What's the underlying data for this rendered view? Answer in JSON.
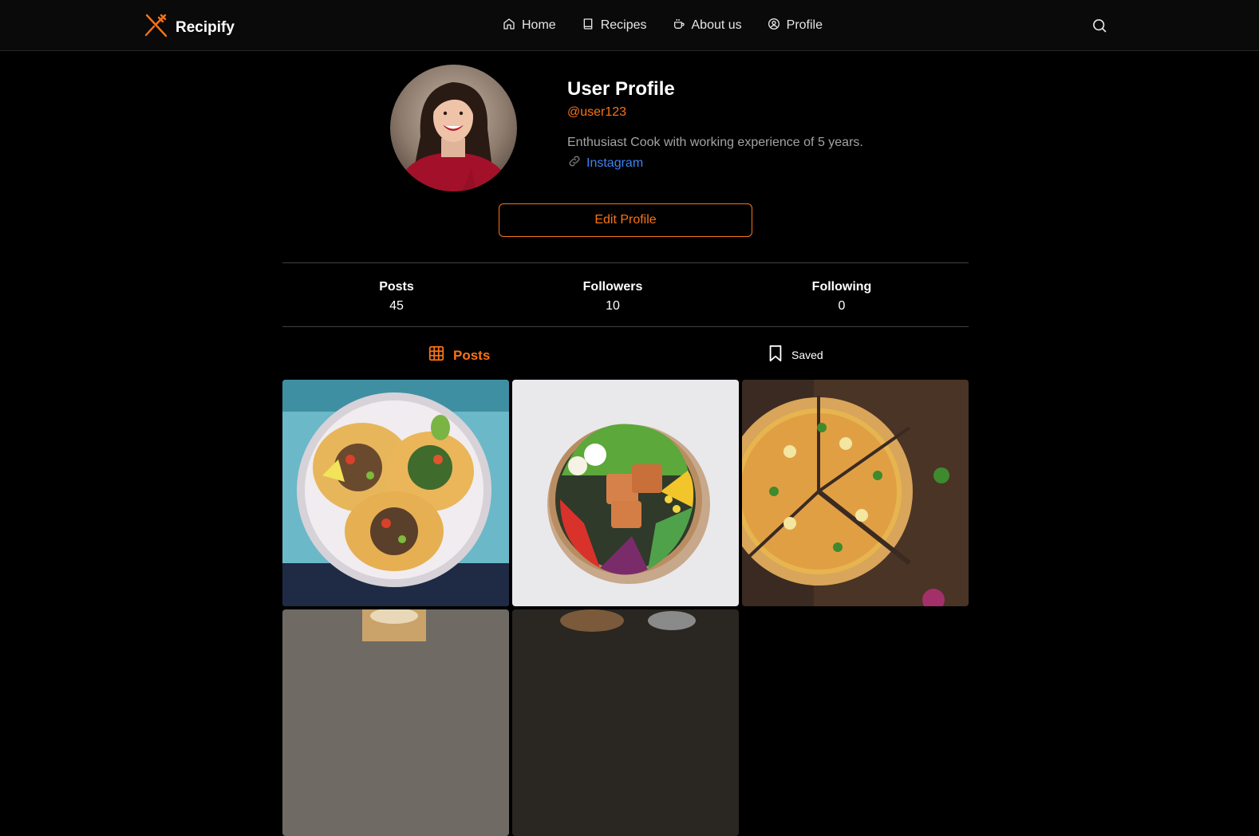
{
  "app": {
    "name": "Recipify"
  },
  "nav": {
    "home": "Home",
    "recipes": "Recipes",
    "about": "About us",
    "profile": "Profile"
  },
  "profile": {
    "name": "User Profile",
    "handle": "@user123",
    "bio": "Enthusiast Cook with working experience of 5 years.",
    "link_label": "Instagram"
  },
  "edit_button": "Edit Profile",
  "stats": [
    {
      "label": "Posts",
      "value": "45"
    },
    {
      "label": "Followers",
      "value": "10"
    },
    {
      "label": "Following",
      "value": "0"
    }
  ],
  "tabs": {
    "posts": "Posts",
    "saved": "Saved"
  },
  "colors": {
    "accent": "#f97316",
    "link": "#3b82f6",
    "background": "#000000",
    "navbar": "#0a0a0a"
  },
  "icons": {
    "logo": "fork-knife-icon",
    "home": "home-icon",
    "recipes": "book-icon",
    "about": "coffee-cup-icon",
    "profile": "user-circle-icon",
    "search": "search-icon",
    "link": "link-icon",
    "posts_tab": "grid-icon",
    "saved_tab": "bookmark-icon"
  }
}
